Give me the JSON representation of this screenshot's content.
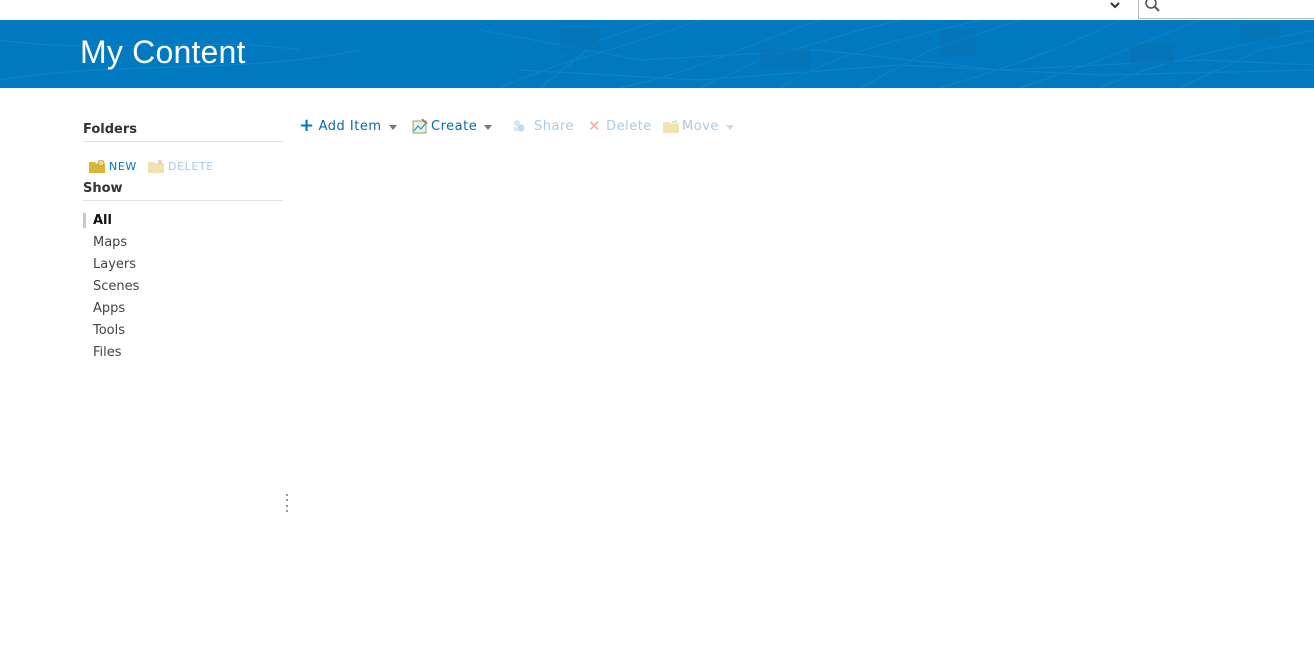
{
  "header": {
    "title": "My Content",
    "banner_color": "#0079c1"
  },
  "topbar": {
    "user_menu_icon": "chevron-down-icon",
    "search": {
      "placeholder": "",
      "value": "",
      "icon": "search-icon"
    }
  },
  "toolbar": {
    "add_item_label": "Add Item",
    "create_label": "Create",
    "share_label": "Share",
    "delete_label": "Delete",
    "move_label": "Move"
  },
  "sidebar": {
    "folders_title": "Folders",
    "new_label": "NEW",
    "delete_label": "DELETE",
    "show_title": "Show",
    "show_items": [
      {
        "label": "All",
        "active": true
      },
      {
        "label": "Maps",
        "active": false
      },
      {
        "label": "Layers",
        "active": false
      },
      {
        "label": "Scenes",
        "active": false
      },
      {
        "label": "Apps",
        "active": false
      },
      {
        "label": "Tools",
        "active": false
      },
      {
        "label": "Files",
        "active": false
      }
    ]
  },
  "colors": {
    "accent": "#0079c1",
    "link": "#0b6aa6",
    "disabled": "#a9cbe4",
    "folder_icon": "#d8b63c"
  }
}
